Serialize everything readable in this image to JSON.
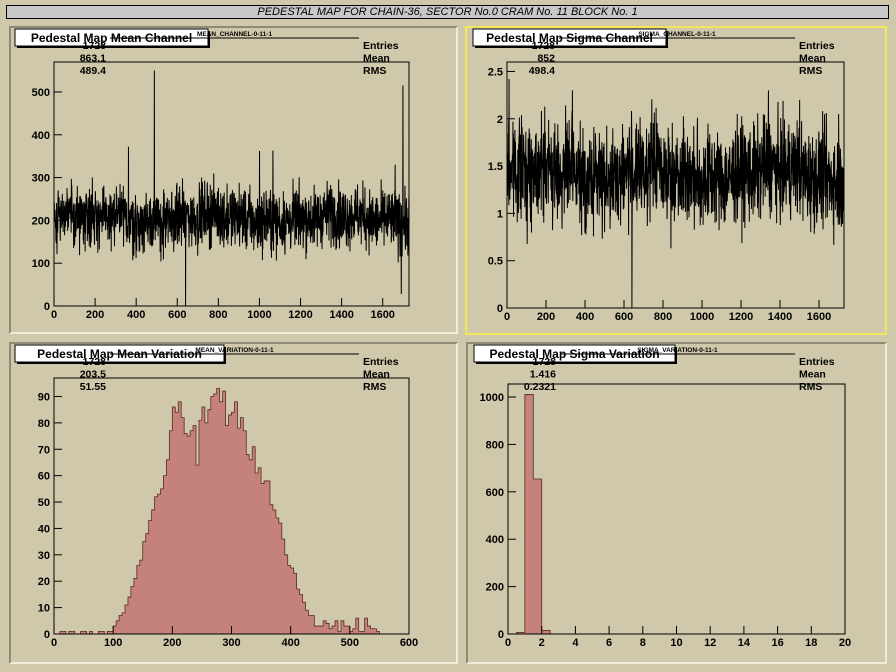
{
  "banner": "PEDESTAL MAP FOR CHAIN-36, SECTOR No.0 CRAM No. 11 BLOCK No. 1",
  "colors": {
    "background": "#cfc8ab",
    "hist_fill": "#c4827a",
    "line": "#000000",
    "active_pad_border": "#f2e65c"
  },
  "chart_data": [
    {
      "type": "line",
      "title": "Pedestal Map Mean Channel",
      "stats": {
        "name": "MEAN_CHANNEL-0-11-1",
        "rows": [
          [
            "Entries",
            "1728"
          ],
          [
            "Mean",
            "863.1"
          ],
          [
            "RMS",
            "489.4"
          ]
        ]
      },
      "xlim": [
        0,
        1728
      ],
      "ylim": [
        0,
        570
      ],
      "xticks": [
        0,
        200,
        400,
        600,
        800,
        1000,
        1200,
        1400,
        1600
      ],
      "yticks": [
        0,
        100,
        200,
        300,
        400,
        500
      ],
      "series": [
        {
          "n": 1728,
          "mean": 205,
          "amp": 35,
          "seed": 11,
          "spikes": [
            [
              488,
              550
            ],
            [
              640,
              0
            ],
            [
              1698,
              515
            ],
            [
              362,
              372
            ],
            [
              1000,
              362
            ],
            [
              1065,
              363
            ],
            [
              1600,
              270
            ],
            [
              1660,
              330
            ],
            [
              1690,
              28
            ]
          ]
        }
      ]
    },
    {
      "type": "line",
      "title": "Pedestal Map Sigma Channel",
      "stats": {
        "name": "SIGMA_CHANNEL-0-11-1",
        "rows": [
          [
            "Entries",
            "1728"
          ],
          [
            "Mean",
            "852"
          ],
          [
            "RMS",
            "498.4"
          ]
        ]
      },
      "xlim": [
        0,
        1728
      ],
      "ylim": [
        0,
        2.6
      ],
      "xticks": [
        0,
        200,
        400,
        600,
        800,
        1000,
        1200,
        1400,
        1600
      ],
      "yticks": [
        0,
        0.5,
        1,
        1.5,
        2,
        2.5
      ],
      "series": [
        {
          "n": 1728,
          "mean": 1.42,
          "amp": 0.25,
          "seed": 7,
          "spikes": [
            [
              10,
              2.42
            ],
            [
              640,
              0
            ],
            [
              335,
              2.3
            ],
            [
              840,
              0.63
            ],
            [
              1340,
              2.3
            ],
            [
              1500,
              2.2
            ],
            [
              1700,
              2.05
            ]
          ]
        }
      ]
    },
    {
      "type": "bar",
      "title": "Pedestal Map Mean Variation",
      "stats": {
        "name": "MEAN_VARIATION-0-11-1",
        "rows": [
          [
            "Entries",
            "1728"
          ],
          [
            "Mean",
            "203.5"
          ],
          [
            "RMS",
            "51.55"
          ]
        ]
      },
      "xlim": [
        0,
        600
      ],
      "ylim": [
        0,
        97
      ],
      "xticks": [
        0,
        100,
        200,
        300,
        400,
        500,
        600
      ],
      "yticks": [
        0,
        10,
        20,
        30,
        40,
        50,
        60,
        70,
        80,
        90
      ],
      "bin_width": 5,
      "bins": [
        0,
        0,
        1,
        1,
        0,
        1,
        1,
        0,
        0,
        1,
        1,
        0,
        1,
        0,
        0,
        1,
        1,
        0,
        1,
        1,
        3,
        5,
        7,
        8,
        11,
        14,
        18,
        21,
        26,
        28,
        35,
        38,
        43,
        47,
        52,
        53,
        55,
        60,
        66,
        77,
        86,
        84,
        88,
        82,
        76,
        75,
        77,
        79,
        64,
        81,
        86,
        80,
        85,
        90,
        91,
        93,
        88,
        92,
        79,
        83,
        84,
        88,
        78,
        82,
        77,
        68,
        66,
        71,
        61,
        63,
        57,
        58,
        58,
        49,
        47,
        44,
        42,
        36,
        30,
        26,
        25,
        23,
        17,
        15,
        12,
        9,
        7,
        7,
        3,
        3,
        3,
        5,
        4,
        2,
        3,
        5,
        1,
        5,
        3,
        3,
        1,
        2,
        6,
        1,
        1,
        6,
        3,
        2,
        2,
        1,
        0,
        0,
        0,
        0,
        0,
        0,
        0,
        0,
        0,
        0
      ]
    },
    {
      "type": "bar",
      "title": "Pedestal Map Sigma Variation",
      "stats": {
        "name": "SIGMA_VARIATION-0-11-1",
        "rows": [
          [
            "Entries",
            "1728"
          ],
          [
            "Mean",
            "1.416"
          ],
          [
            "RMS",
            "0.2321"
          ]
        ]
      },
      "xlim": [
        0,
        20
      ],
      "ylim": [
        0,
        1055
      ],
      "xticks": [
        0,
        2,
        4,
        6,
        8,
        10,
        12,
        14,
        16,
        18,
        20
      ],
      "yticks": [
        0,
        200,
        400,
        600,
        800,
        1000
      ],
      "bin_width": 0.5,
      "bins": [
        0,
        6,
        1011,
        654,
        15,
        0,
        0,
        0,
        0,
        0,
        0,
        0,
        0,
        0,
        0,
        0,
        0,
        0,
        0,
        0,
        0,
        0,
        0,
        0,
        0,
        0,
        0,
        0,
        0,
        0,
        0,
        0,
        0,
        0,
        0,
        0,
        0,
        0,
        0,
        0
      ]
    }
  ]
}
